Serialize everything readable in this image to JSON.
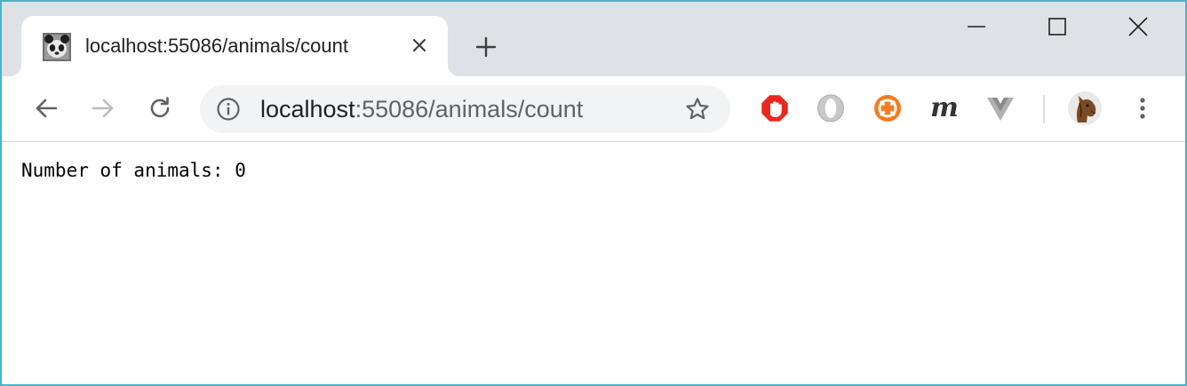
{
  "tab": {
    "title": "localhost:55086/animals/count",
    "favicon": "panda-icon"
  },
  "window_controls": [
    "minimize-icon",
    "maximize-icon",
    "close-icon"
  ],
  "omnibox": {
    "host": "localhost",
    "path": ":55086/animals/count"
  },
  "extensions": [
    {
      "name": "adblock-icon",
      "color": "#e8291c"
    },
    {
      "name": "opera-icon",
      "color": "#bdbdbd"
    },
    {
      "name": "lifebuoy-icon",
      "color": "#f47b20"
    },
    {
      "name": "m-extension-icon",
      "label": "m"
    },
    {
      "name": "vue-devtools-icon",
      "color": "#b0b0b0"
    }
  ],
  "page": {
    "text": "Number of animals: 0"
  }
}
